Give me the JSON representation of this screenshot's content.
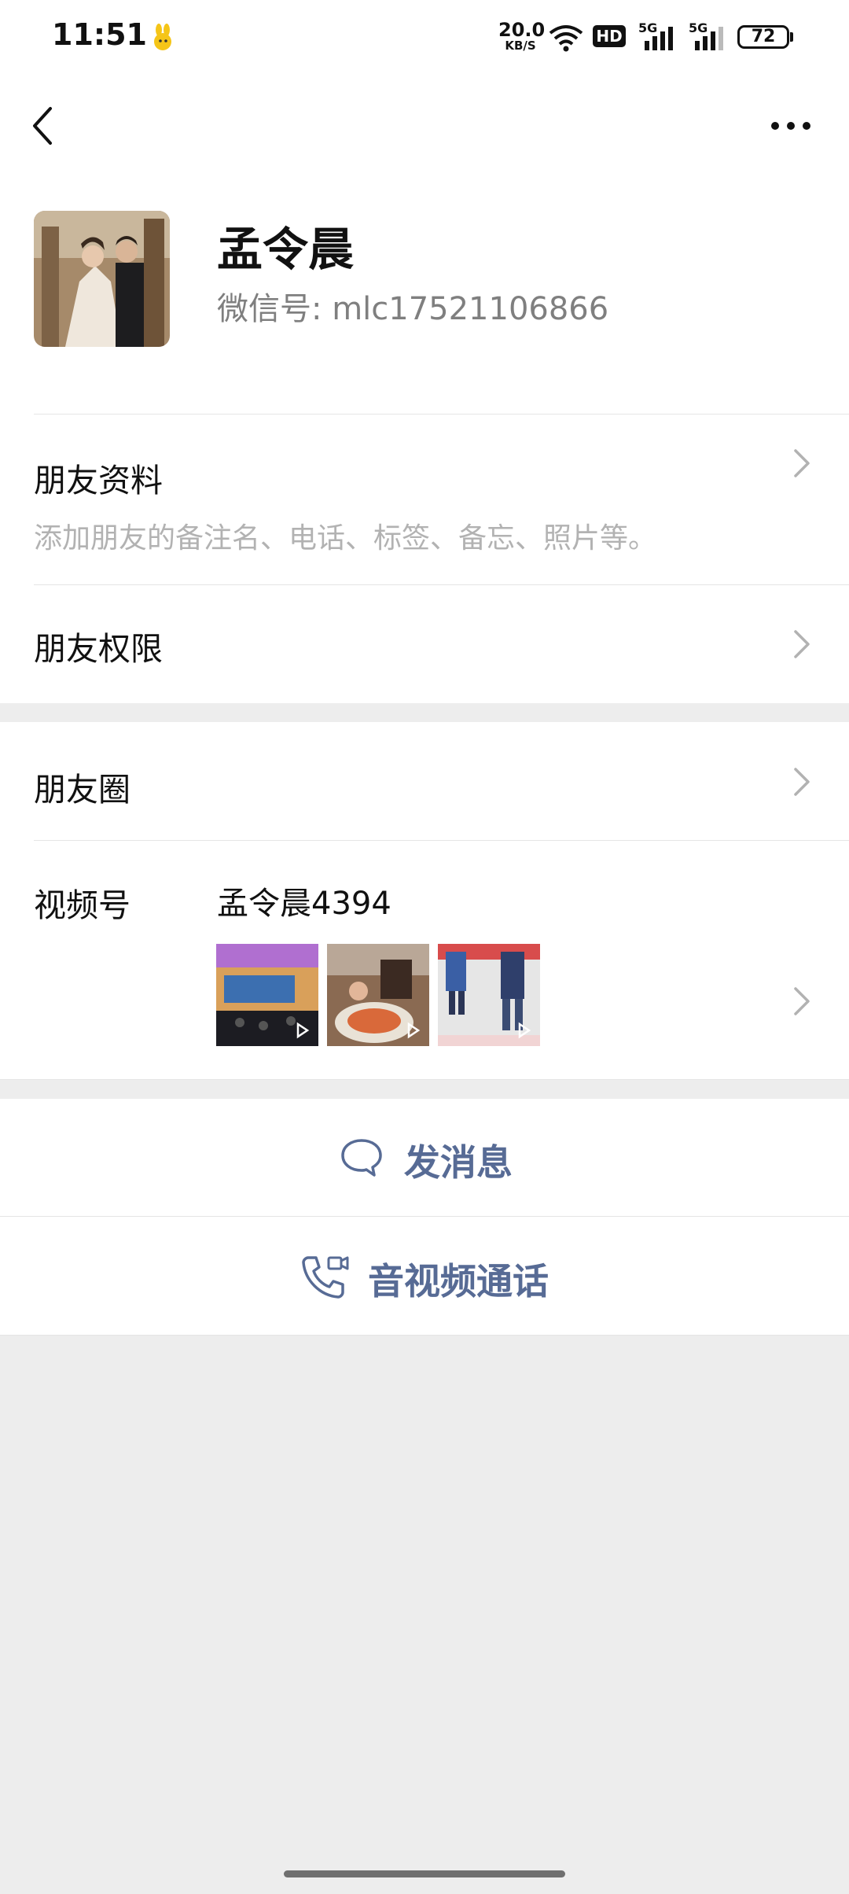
{
  "status_bar": {
    "time": "11:51",
    "net_speed_value": "20.0",
    "net_speed_unit": "KB/S",
    "hd_label": "HD",
    "sig1_label": "5G",
    "sig2_label": "5G",
    "battery": "72"
  },
  "nav": {
    "back_icon": "chevron-left-icon",
    "more_icon": "more-dots-icon"
  },
  "profile": {
    "name": "孟令晨",
    "wechat_id": "微信号: mlc17521106866"
  },
  "rows": {
    "friend_info_title": "朋友资料",
    "friend_info_sub": "添加朋友的备注名、电话、标签、备忘、照片等。",
    "friend_perm_title": "朋友权限",
    "moments_title": "朋友圈",
    "channels_title": "视频号",
    "channels_name": "孟令晨4394"
  },
  "actions": {
    "message_label": "发消息",
    "call_label": "音视频通话"
  },
  "colors": {
    "accent": "#576b95",
    "background": "#ededed",
    "secondary_text": "#7f7f7f"
  }
}
